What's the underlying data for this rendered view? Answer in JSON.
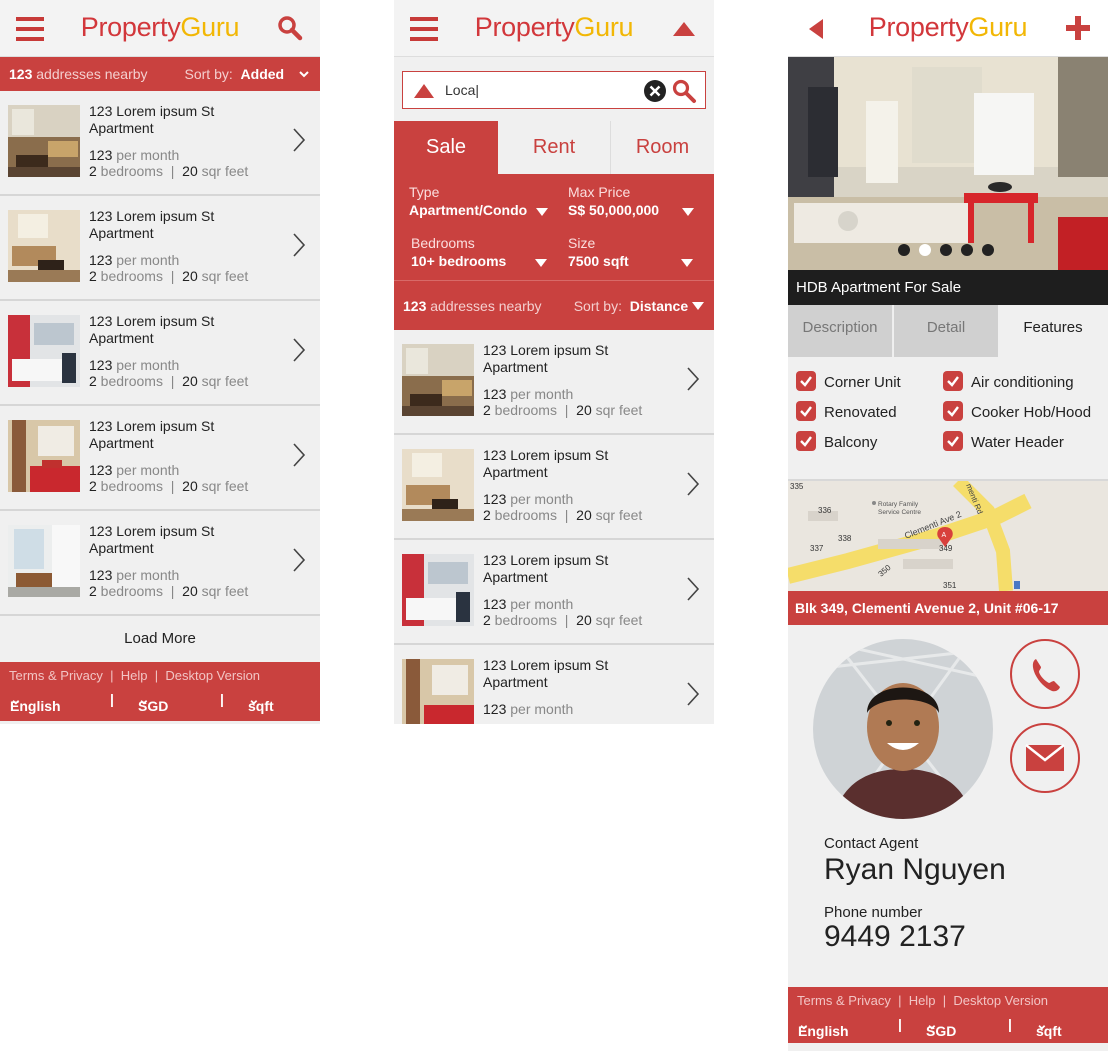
{
  "brand": {
    "part1": "Property",
    "part2": "Guru"
  },
  "colors": {
    "accent": "#c9413f",
    "brand_red": "#d2373b",
    "brand_yellow": "#f2b705"
  },
  "screen1": {
    "count": "123",
    "count_suffix": " addresses nearby",
    "sort_label": "Sort by:",
    "sort_value": "Added",
    "listings": [
      {
        "title": "123 Lorem ipsum  St Apartment",
        "price": "123",
        "price_suffix": " per month",
        "beds": "2",
        "beds_suffix": " bedrooms",
        "sqft": "20",
        "sqft_suffix": " sqr feet"
      },
      {
        "title": "123 Lorem ipsum  St Apartment",
        "price": "123",
        "price_suffix": " per month",
        "beds": "2",
        "beds_suffix": " bedrooms",
        "sqft": "20",
        "sqft_suffix": " sqr feet"
      },
      {
        "title": "123 Lorem ipsum  St Apartment",
        "price": "123",
        "price_suffix": " per month",
        "beds": "2",
        "beds_suffix": " bedrooms",
        "sqft": "20",
        "sqft_suffix": " sqr feet"
      },
      {
        "title": "123 Lorem ipsum  St Apartment",
        "price": "123",
        "price_suffix": " per month",
        "beds": "2",
        "beds_suffix": " bedrooms",
        "sqft": "20",
        "sqft_suffix": " sqr feet"
      },
      {
        "title": "123 Lorem ipsum  St Apartment",
        "price": "123",
        "price_suffix": " per month",
        "beds": "2",
        "beds_suffix": " bedrooms",
        "sqft": "20",
        "sqft_suffix": " sqr feet"
      }
    ],
    "load_more": "Load More"
  },
  "footer": {
    "links": [
      "Terms & Privacy",
      "Help",
      "Desktop Version"
    ],
    "sep": "|",
    "language": "English",
    "currency": "SGD",
    "unit": "sqft"
  },
  "screen2": {
    "search_value": "Loca|",
    "tabs": [
      "Sale",
      "Rent",
      "Room"
    ],
    "filters": [
      {
        "label": "Type",
        "value": "Apartment/Condo"
      },
      {
        "label": "Max Price",
        "value": "S$ 50,000,000"
      },
      {
        "label": "Bedrooms",
        "value": "10+ bedrooms"
      },
      {
        "label": "Size",
        "value": "7500 sqft"
      }
    ],
    "count": "123",
    "count_suffix": " addresses nearby",
    "sort_label": "Sort by:",
    "sort_value": "Distance",
    "listings": [
      {
        "title": "123 Lorem ipsum  St Apartment",
        "price": "123",
        "price_suffix": " per month",
        "beds": "2",
        "beds_suffix": " bedrooms",
        "sqft": "20",
        "sqft_suffix": " sqr feet"
      },
      {
        "title": "123 Lorem ipsum  St Apartment",
        "price": "123",
        "price_suffix": " per month",
        "beds": "2",
        "beds_suffix": " bedrooms",
        "sqft": "20",
        "sqft_suffix": " sqr feet"
      },
      {
        "title": "123 Lorem ipsum  St Apartment",
        "price": "123",
        "price_suffix": " per month",
        "beds": "2",
        "beds_suffix": " bedrooms",
        "sqft": "20",
        "sqft_suffix": " sqr feet"
      },
      {
        "title": "123 Lorem ipsum  St Apartment",
        "price": "123",
        "price_suffix": " per month",
        "beds": "",
        "beds_suffix": "",
        "sqft": "",
        "sqft_suffix": ""
      }
    ]
  },
  "screen3": {
    "caption": "HDB Apartment For Sale",
    "tabs": [
      "Description",
      "Detail",
      "Features"
    ],
    "features_left": [
      "Corner Unit",
      "Renovated",
      "Balcony"
    ],
    "features_right": [
      "Air conditioning",
      "Cooker Hob/Hood",
      "Water Header"
    ],
    "map_labels": [
      "335",
      "336",
      "Rotary Family",
      "Service Centre",
      "Clementi Ave 2",
      "menti Rd",
      "337",
      "338",
      "349",
      "350",
      "351",
      "A"
    ],
    "address": "Blk 349, Clementi Avenue 2, Unit #06-17",
    "contact_label": "Contact Agent",
    "agent_name": "Ryan Nguyen",
    "phone_label": "Phone number",
    "phone": "9449 2137"
  }
}
